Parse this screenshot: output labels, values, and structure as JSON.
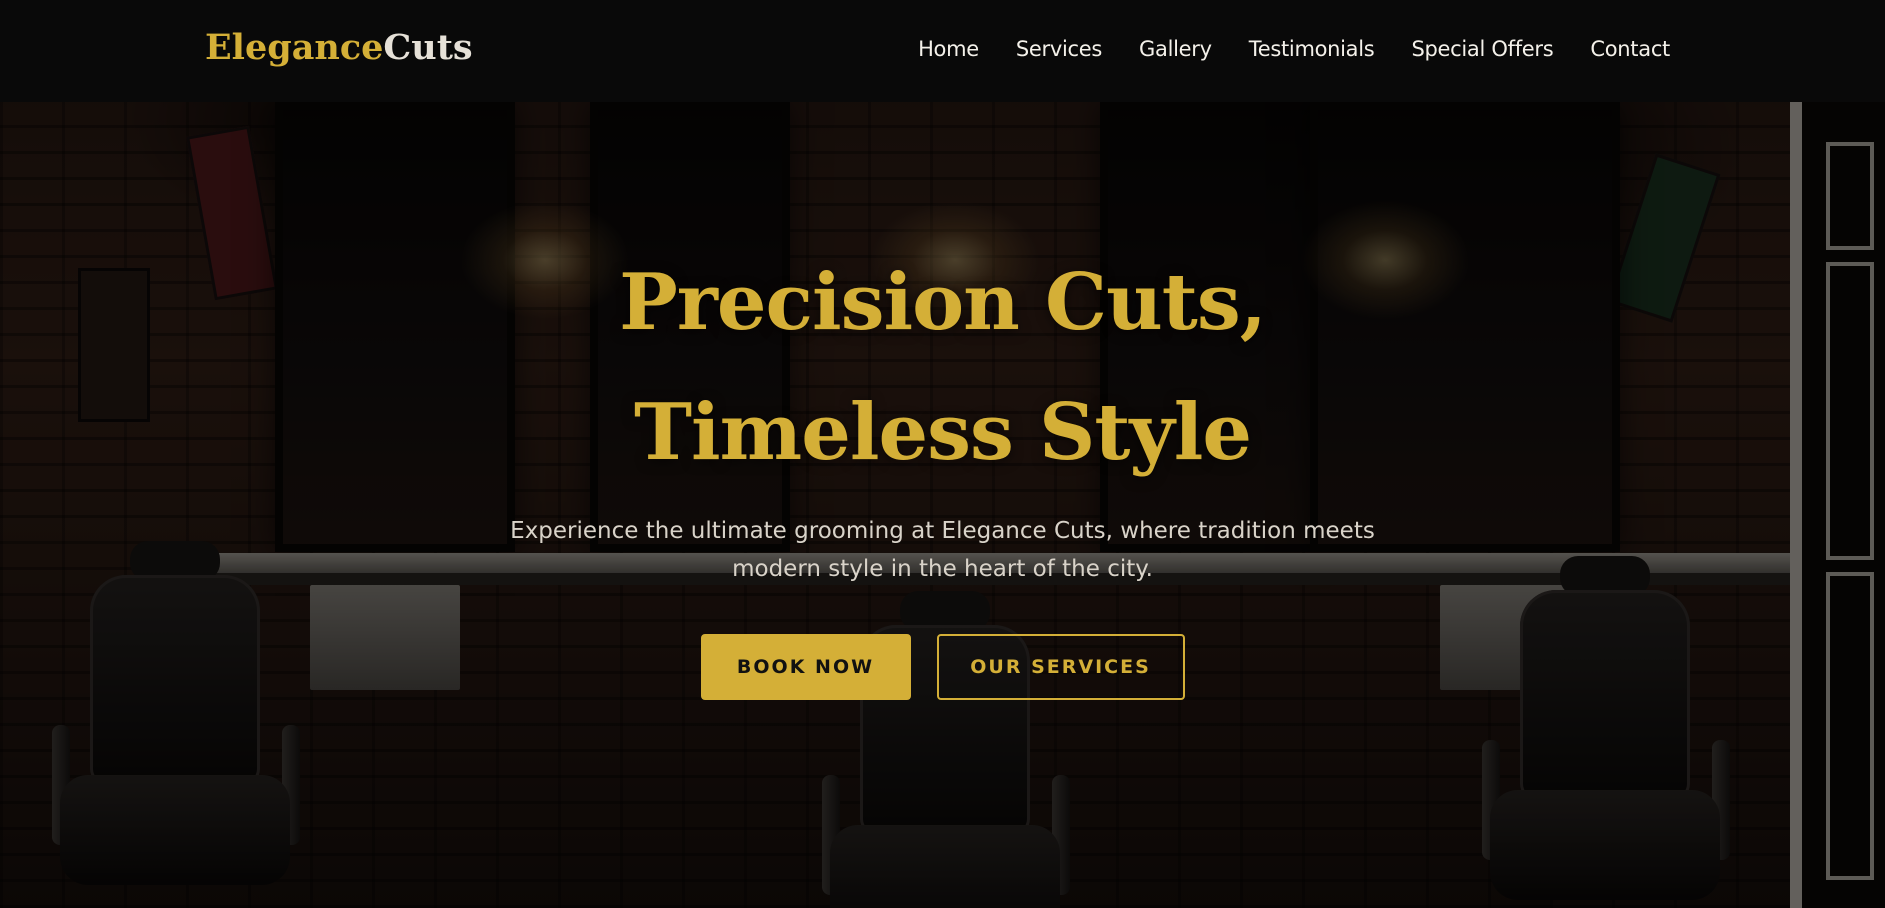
{
  "brand": {
    "name_part1": "Elegance",
    "name_part2": "Cuts"
  },
  "nav": {
    "items": [
      {
        "label": "Home"
      },
      {
        "label": "Services"
      },
      {
        "label": "Gallery"
      },
      {
        "label": "Testimonials"
      },
      {
        "label": "Special Offers"
      },
      {
        "label": "Contact"
      }
    ]
  },
  "hero": {
    "title": "Precision Cuts, Timeless Style",
    "subtitle": "Experience the ultimate grooming at Elegance Cuts, where tradition meets modern style in the heart of the city.",
    "primary_cta": "BOOK NOW",
    "secondary_cta": "OUR SERVICES"
  },
  "colors": {
    "accent": "#d4af37",
    "nav_background": "#090909",
    "text_light": "#f4f1ea"
  }
}
